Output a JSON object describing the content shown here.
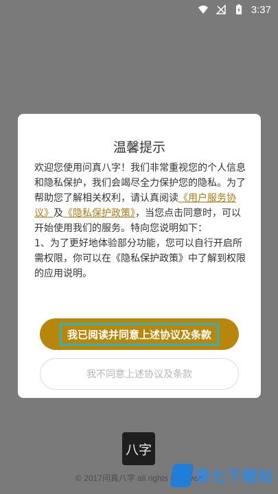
{
  "status_bar": {
    "time": "3:37",
    "icons": [
      "wifi-icon",
      "no-signal-icon",
      "battery-charging-icon"
    ]
  },
  "dialog": {
    "title": "温馨提示",
    "body": {
      "p1_prefix": "欢迎您使用问真八字！我们非常重视您的个人信息和隐私保护，我们会竭尽全力保护您的隐私。为了帮助您了解相关权利，请认真阅读",
      "link_agreement": "《用户服务协议》",
      "conj": "及",
      "link_privacy": "《隐私保护政策》",
      "p1_suffix": "，当您点击同意时，可以开始使用我们的服务。特向您说明如下：",
      "p2": "1、为了更好地体验部分功能，您可以自行开启所需权限，你可以在《隐私保护政策》中了解到权限的应用说明。"
    },
    "agree_label": "我已阅读并同意上述协议及条款",
    "disagree_label": "我不同意上述协议及条款"
  },
  "footer": {
    "logo_text": "八字",
    "copyright": "© 2017问真八字 all rights reserved"
  },
  "watermark": {
    "text": "第七下载站"
  },
  "colors": {
    "overlay": "#7a7a7a",
    "accent": "#b8860b",
    "link": "#b07a10",
    "highlight_frame": "#29b4c8"
  }
}
